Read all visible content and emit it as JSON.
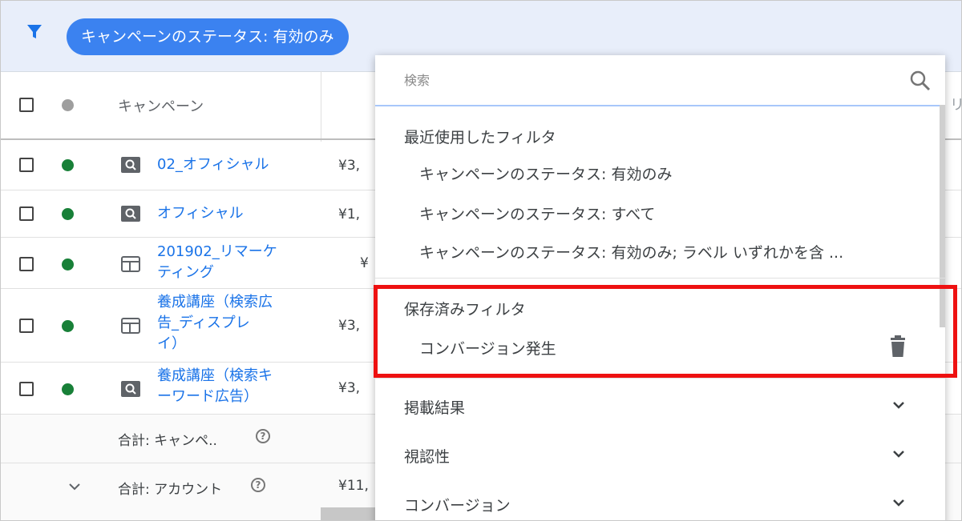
{
  "filter_bar": {
    "chip_label": "キャンペーンのステータス: 有効のみ",
    "accent_color": "#3b82f0"
  },
  "table": {
    "header": {
      "campaign_label": "キャンペーン",
      "right_edge_text": "リ"
    },
    "rows": [
      {
        "name_lines": [
          "02_オフィシャル"
        ],
        "type_icon": "search-campaign-icon",
        "status": "enabled",
        "cost": "¥3,"
      },
      {
        "name_lines": [
          "オフィシャル"
        ],
        "type_icon": "search-campaign-icon",
        "status": "enabled",
        "cost": "¥1,"
      },
      {
        "name_lines": [
          "201902_リマーケ",
          "ティング"
        ],
        "type_icon": "display-campaign-icon",
        "status": "enabled",
        "cost": "¥"
      },
      {
        "name_lines": [
          "養成講座（検索広",
          "告_ディスプレ",
          "イ）"
        ],
        "type_icon": "display-campaign-icon",
        "status": "enabled",
        "cost": "¥3,"
      },
      {
        "name_lines": [
          "養成講座（検索キ",
          "ーワード広告）"
        ],
        "type_icon": "search-campaign-icon",
        "status": "enabled",
        "cost": "¥3,"
      }
    ],
    "totals": [
      {
        "label": "合計: キャンペ..",
        "help": "?"
      },
      {
        "label": "合計: アカウント",
        "help": "?",
        "cost": "¥11,"
      }
    ]
  },
  "dropdown": {
    "search_placeholder": "検索",
    "recent": {
      "title": "最近使用したフィルタ",
      "items": [
        "キャンペーンのステータス: 有効のみ",
        "キャンペーンのステータス: すべて",
        "キャンペーンのステータス: 有効のみ; ラベル いずれかを含 ..."
      ]
    },
    "saved": {
      "title": "保存済みフィルタ",
      "items": [
        "コンバージョン発生"
      ]
    },
    "categories": [
      "掲載結果",
      "視認性",
      "コンバージョン"
    ]
  },
  "highlight_color": "#ee1111"
}
